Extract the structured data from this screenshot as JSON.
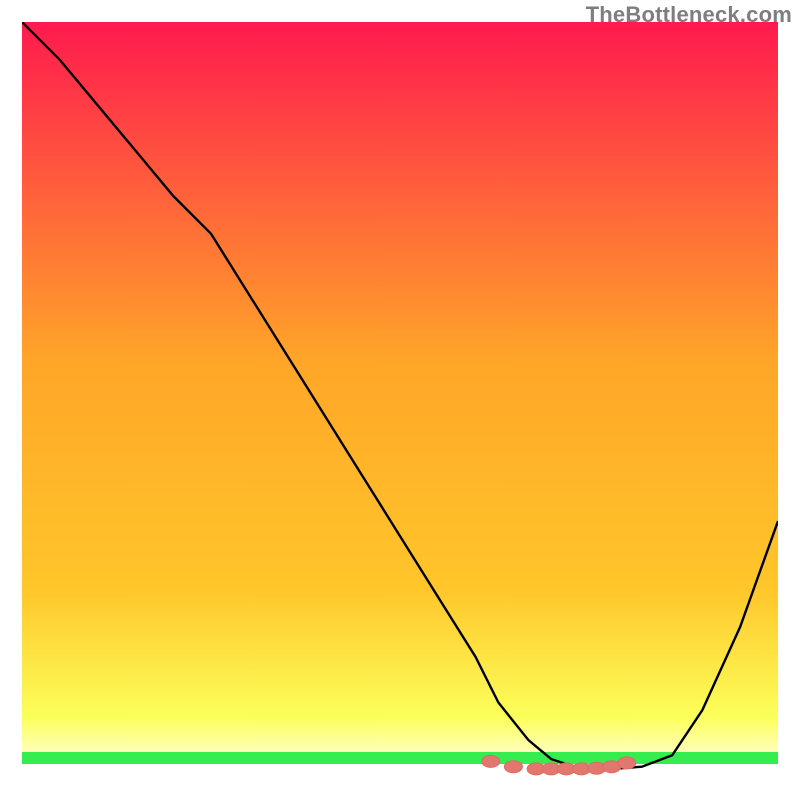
{
  "watermark": "TheBottleneck.com",
  "colors": {
    "curve": "#000000",
    "marker_fill": "#e2776f",
    "marker_stroke": "#de6b63",
    "green_band": "#35ed4e",
    "gradient_top": "#ff1a4e",
    "gradient_mid": "#ffc62a",
    "gradient_low": "#fbff5a",
    "gradient_bottom": "#ffffff"
  },
  "chart_data": {
    "type": "line",
    "title": "",
    "xlabel": "",
    "ylabel": "",
    "xlim": [
      0,
      100
    ],
    "ylim": [
      0,
      100
    ],
    "grid": false,
    "legend": false,
    "series": [
      {
        "name": "bottleneck-curve",
        "x": [
          0,
          5,
          10,
          15,
          20,
          25,
          30,
          35,
          40,
          45,
          50,
          55,
          60,
          63,
          67,
          70,
          74,
          78,
          82,
          86,
          90,
          95,
          100
        ],
        "y": [
          100,
          95,
          89,
          83,
          77,
          72,
          64,
          56,
          48,
          40,
          32,
          24,
          16,
          10,
          5,
          2.5,
          1.2,
          1.2,
          1.5,
          3,
          9,
          20,
          34
        ]
      },
      {
        "name": "optimal-markers",
        "x": [
          62,
          65,
          68,
          70,
          72,
          74,
          76,
          78,
          80
        ],
        "y": [
          2.2,
          1.5,
          1.2,
          1.2,
          1.2,
          1.2,
          1.3,
          1.5,
          2.0
        ]
      }
    ],
    "annotations": []
  }
}
